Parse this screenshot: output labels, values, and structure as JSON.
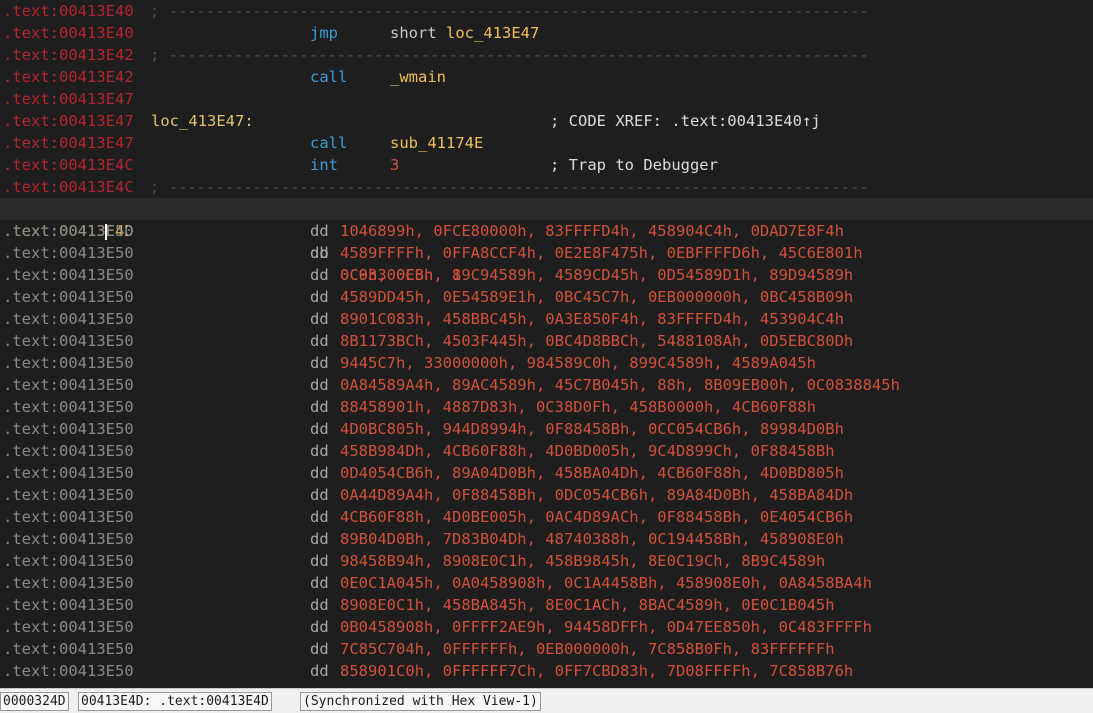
{
  "colors": {
    "background": "#1e1e1e",
    "address_red": "#b3262b",
    "address_gray": "#8a8a8a",
    "address_current": "#f0c058",
    "mnemonic": "#3b9cd6",
    "operand_name": "#f0c058",
    "number": "#d2513a",
    "label": "#e0c46c",
    "separator": "#4f4f4f"
  },
  "code_rows": [
    {
      "addr": ".text:00413E40",
      "sep": "; ---------------------------------------------------------------------------"
    },
    {
      "addr": ".text:00413E40",
      "mnemonic": "jmp",
      "operand_kw": "short ",
      "operand": "loc_413E47"
    },
    {
      "addr": ".text:00413E42",
      "sep": "; ---------------------------------------------------------------------------"
    },
    {
      "addr": ".text:00413E42",
      "mnemonic": "call",
      "operand": "_wmain"
    },
    {
      "addr": ".text:00413E47"
    },
    {
      "addr": ".text:00413E47",
      "label": "loc_413E47:",
      "comment": "; CODE XREF: .text:00413E40↑j"
    },
    {
      "addr": ".text:00413E47",
      "mnemonic": "call",
      "operand": "sub_41174E"
    },
    {
      "addr": ".text:00413E4C",
      "mnemonic": "int",
      "operand_num": "3",
      "comment": "; Trap to Debugger"
    },
    {
      "addr": ".text:00413E4C",
      "sep": "; ---------------------------------------------------------------------------"
    }
  ],
  "current_row": {
    "addr_before": ".text:00413",
    "addr_after": "E4D",
    "directive": "db",
    "values": "0C9h, 0EBh, 1"
  },
  "data_rows": [
    {
      "addr": ".text:00413E50",
      "directive": "dd",
      "values": "1046899h, 0FCE80000h, 83FFFFD4h, 458904C4h, 0DAD7E8F4h"
    },
    {
      "addr": ".text:00413E50",
      "directive": "dd",
      "values": "4589FFFFh, 0FFA8CCF4h, 0E2E8F475h, 0EBFFFFD6h, 45C6E801h"
    },
    {
      "addr": ".text:00413E50",
      "directive": "dd",
      "values": "0C03300C8h, 89C94589h, 4589CD45h, 0D54589D1h, 89D94589h"
    },
    {
      "addr": ".text:00413E50",
      "directive": "dd",
      "values": "4589DD45h, 0E54589E1h, 0BC45C7h, 0EB000000h, 0BC458B09h"
    },
    {
      "addr": ".text:00413E50",
      "directive": "dd",
      "values": "8901C083h, 458BBC45h, 0A3E850F4h, 83FFFFD4h, 453904C4h"
    },
    {
      "addr": ".text:00413E50",
      "directive": "dd",
      "values": "8B1173BCh, 4503F445h, 0BC4D8BBCh, 5488108Ah, 0D5EBC80Dh"
    },
    {
      "addr": ".text:00413E50",
      "directive": "dd",
      "values": "9445C7h, 33000000h, 984589C0h, 899C4589h, 4589A045h"
    },
    {
      "addr": ".text:00413E50",
      "directive": "dd",
      "values": "0A84589A4h, 89AC4589h, 45C7B045h, 88h, 8B09EB00h, 0C0838845h"
    },
    {
      "addr": ".text:00413E50",
      "directive": "dd",
      "values": "88458901h, 4887D83h, 0C38D0Fh, 458B0000h, 4CB60F88h"
    },
    {
      "addr": ".text:00413E50",
      "directive": "dd",
      "values": "4D0BC805h, 944D8994h, 0F88458Bh, 0CC054CB6h, 89984D0Bh"
    },
    {
      "addr": ".text:00413E50",
      "directive": "dd",
      "values": "458B984Dh, 4CB60F88h, 4D0BD005h, 9C4D899Ch, 0F88458Bh"
    },
    {
      "addr": ".text:00413E50",
      "directive": "dd",
      "values": "0D4054CB6h, 89A04D0Bh, 458BA04Dh, 4CB60F88h, 4D0BD805h"
    },
    {
      "addr": ".text:00413E50",
      "directive": "dd",
      "values": "0A44D89A4h, 0F88458Bh, 0DC054CB6h, 89A84D0Bh, 458BA84Dh"
    },
    {
      "addr": ".text:00413E50",
      "directive": "dd",
      "values": "4CB60F88h, 4D0BE005h, 0AC4D89ACh, 0F88458Bh, 0E4054CB6h"
    },
    {
      "addr": ".text:00413E50",
      "directive": "dd",
      "values": "89B04D0Bh, 7D83B04Dh, 48740388h, 0C194458Bh, 458908E0h"
    },
    {
      "addr": ".text:00413E50",
      "directive": "dd",
      "values": "98458B94h, 8908E0C1h, 458B9845h, 8E0C19Ch, 8B9C4589h"
    },
    {
      "addr": ".text:00413E50",
      "directive": "dd",
      "values": "0E0C1A045h, 0A0458908h, 0C1A4458Bh, 458908E0h, 0A8458BA4h"
    },
    {
      "addr": ".text:00413E50",
      "directive": "dd",
      "values": "8908E0C1h, 458BA845h, 8E0C1ACh, 8BAC4589h, 0E0C1B045h"
    },
    {
      "addr": ".text:00413E50",
      "directive": "dd",
      "values": "0B0458908h, 0FFFF2AE9h, 94458DFFh, 0D47EE850h, 0C483FFFFh"
    },
    {
      "addr": ".text:00413E50",
      "directive": "dd",
      "values": "7C85C704h, 0FFFFFFh, 0EB000000h, 7C858B0Fh, 83FFFFFFh"
    },
    {
      "addr": ".text:00413E50",
      "directive": "dd",
      "values": "858901C0h, 0FFFFFF7Ch, 0FF7CBD83h, 7D08FFFFh, 7C858B76h"
    }
  ],
  "status_bar": {
    "file_offset": "0000324D",
    "location": "00413E4D: .text:00413E4D",
    "sync": "(Synchronized with Hex View-1)"
  }
}
